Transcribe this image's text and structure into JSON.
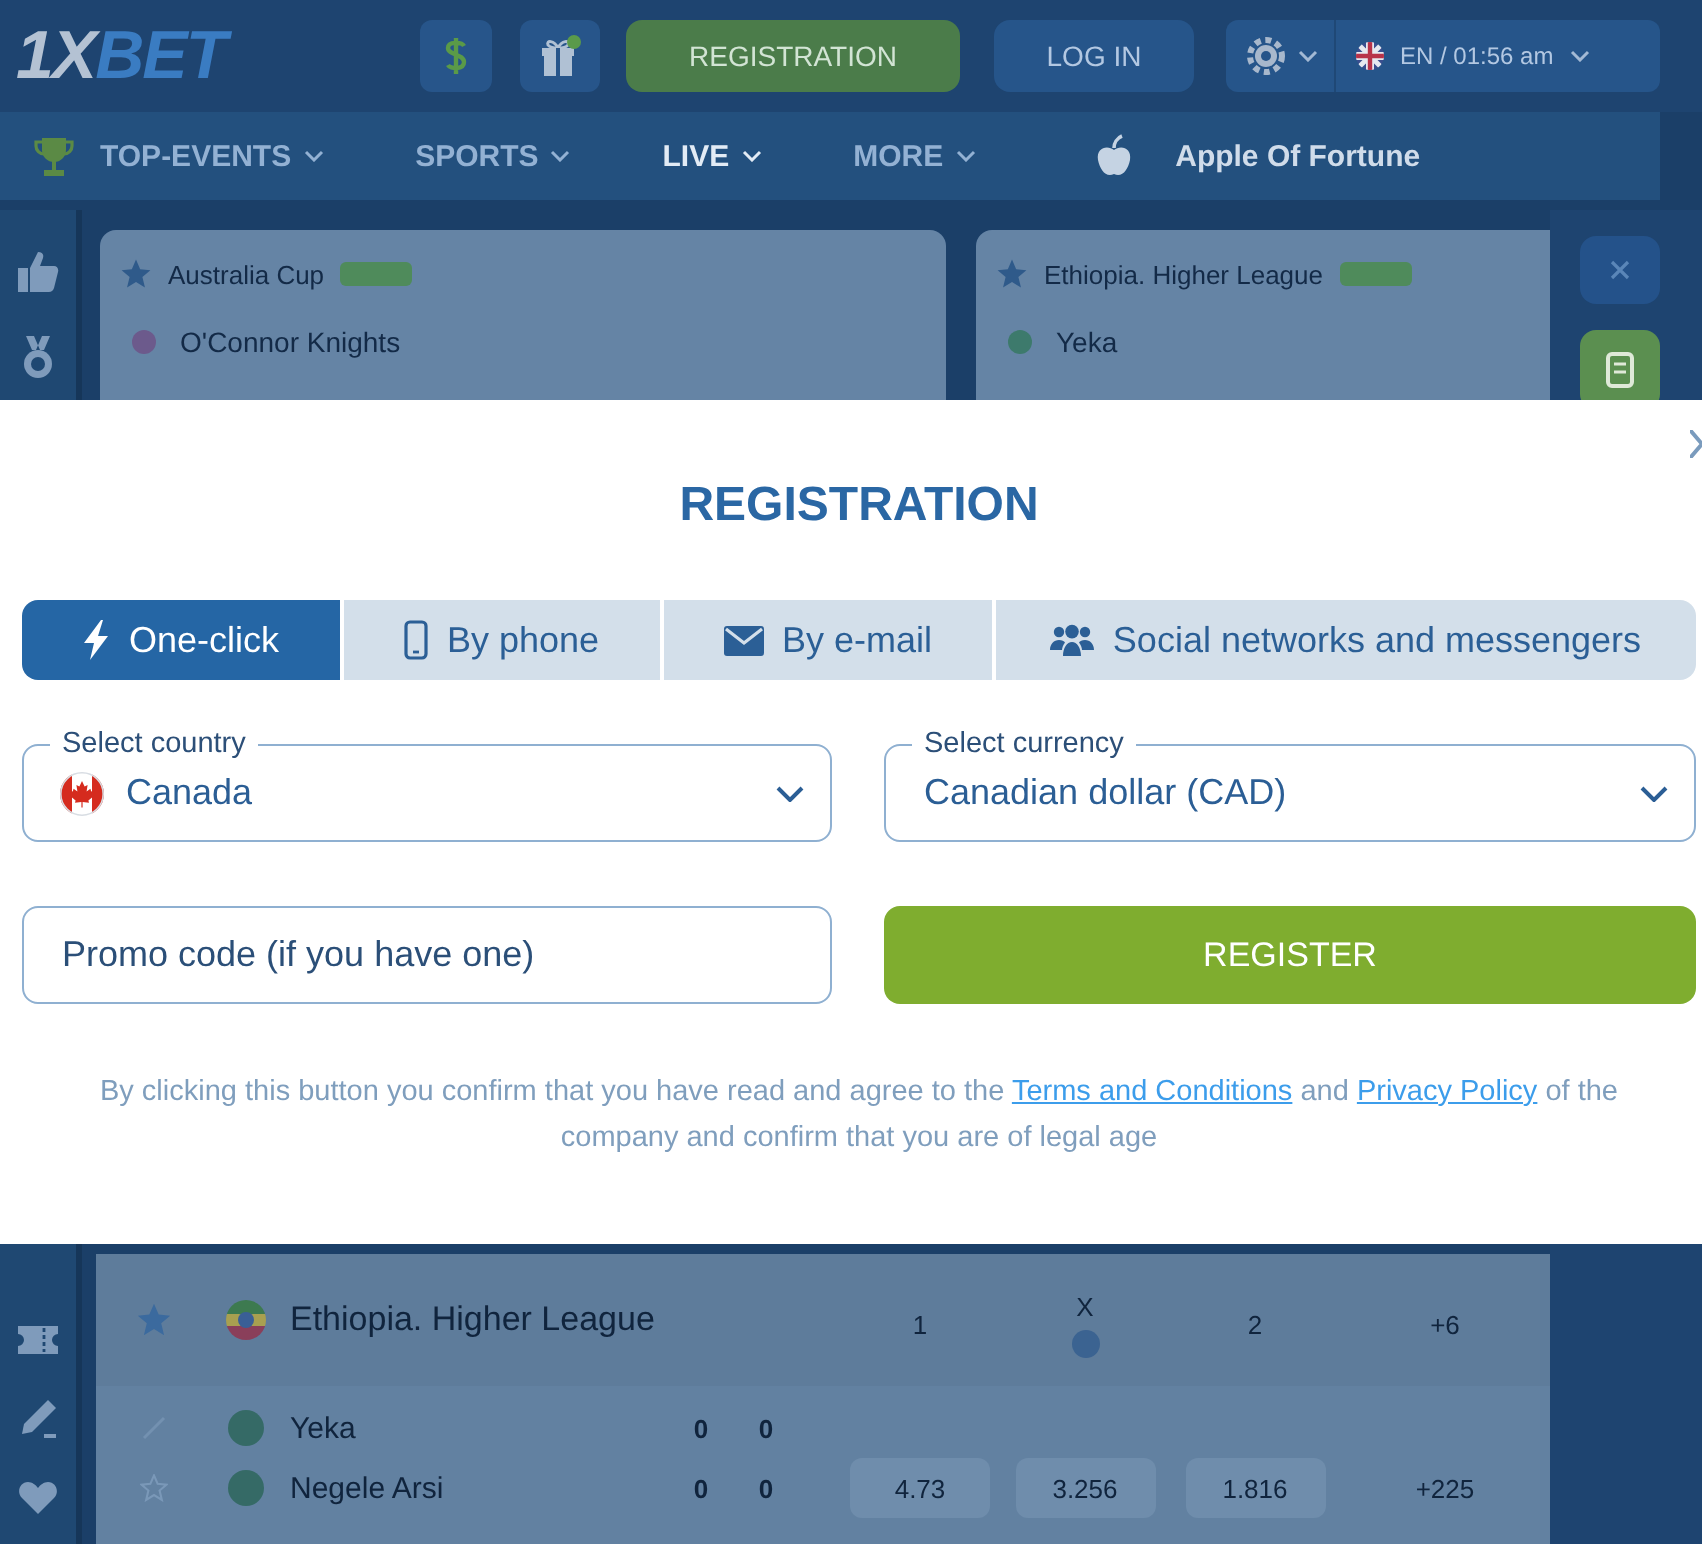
{
  "background": {
    "header": {
      "logo": {
        "light": "1X",
        "accent": "BET"
      },
      "register_button": "REGISTRATION",
      "login_button": "LOG IN",
      "language": "EN / 01:56 am"
    },
    "nav": {
      "menus": [
        {
          "label": "TOP-EVENTS",
          "selected": false
        },
        {
          "label": "SPORTS",
          "selected": false
        },
        {
          "label": "LIVE",
          "selected": true
        },
        {
          "label": "MORE",
          "selected": false
        }
      ],
      "game": "Apple Of Fortune"
    },
    "cards": [
      {
        "league": "Australia Cup",
        "teams": [
          "O'Connor Knights"
        ]
      },
      {
        "league": "Ethiopia. Higher League",
        "teams": [
          "Yeka"
        ]
      }
    ],
    "table": {
      "league": "Ethiopia. Higher League",
      "columns": [
        "1",
        "X",
        "2",
        "+6"
      ],
      "rows": [
        {
          "team": "Yeka",
          "scores": [
            "0",
            "0"
          ]
        },
        {
          "team": "Negele Arsi",
          "scores": [
            "0",
            "0"
          ]
        }
      ],
      "odds": [
        "4.73",
        "3.256",
        "1.816"
      ],
      "more_markets": "+225"
    }
  },
  "dialog": {
    "title": "REGISTRATION",
    "tabs": [
      {
        "label": "One-click",
        "selected": true
      },
      {
        "label": "By phone",
        "selected": false
      },
      {
        "label": "By e-mail",
        "selected": false
      },
      {
        "label": "Social networks and messengers",
        "selected": false
      }
    ],
    "country": {
      "label": "Select country",
      "value": "Canada"
    },
    "currency": {
      "label": "Select currency",
      "value": "Canadian dollar (CAD)"
    },
    "promo": {
      "placeholder": "Promo code (if you have one)"
    },
    "register_button": "REGISTER",
    "disclaimer": {
      "before": "By clicking this button you confirm that you have read and agree to the ",
      "terms_link": "Terms and Conditions",
      "middle": " and ",
      "privacy_link": "Privacy Policy",
      "after": " of the company and confirm that you are of legal age"
    }
  }
}
